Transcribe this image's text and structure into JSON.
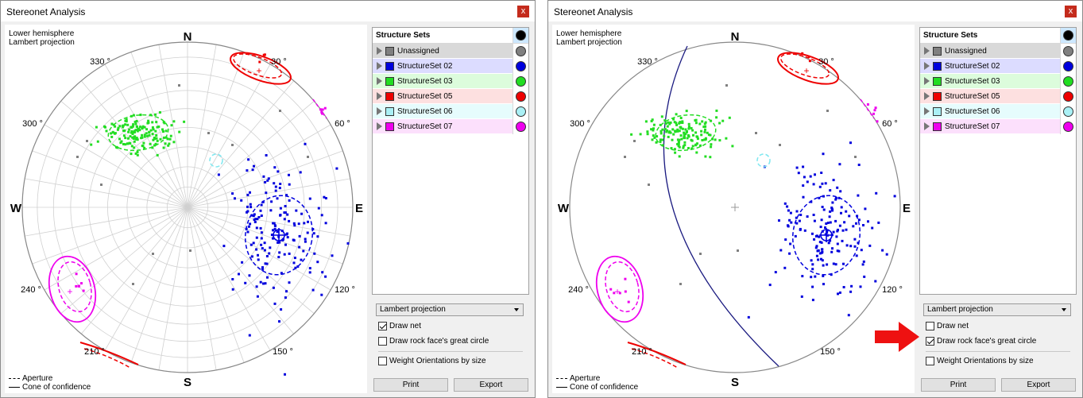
{
  "windows": [
    {
      "title": "Stereonet Analysis",
      "close_label": "x",
      "hemisphere": "Lower hemisphere",
      "projection_text": "Lambert projection",
      "net_drawn": true,
      "great_circle_drawn": false,
      "compass": {
        "n": "N",
        "s": "S",
        "e": "E",
        "w": "W"
      },
      "angles": {
        "a330": "330 °",
        "a30": "30 °",
        "a300": "300 °",
        "a60": "60 °",
        "a240": "240 °",
        "a120": "120 °",
        "a210": "210 °",
        "a150": "150 °"
      },
      "legend": {
        "aperture": "Aperture",
        "cone": "Cone of confidence"
      },
      "structure_header": "Structure Sets",
      "structures": [
        {
          "name": "Unassigned",
          "color": "#808080",
          "bg": "#d9d9d9"
        },
        {
          "name": "StructureSet 02",
          "color": "#0000dd",
          "bg": "#dcdcff"
        },
        {
          "name": "StructureSet 03",
          "color": "#22dd22",
          "bg": "#dcfcdc"
        },
        {
          "name": "StructureSet 05",
          "color": "#ee0000",
          "bg": "#fde0e0"
        },
        {
          "name": "StructureSet 06",
          "color": "#aaf0f5",
          "bg": "#e6fcfd"
        },
        {
          "name": "StructureSet 07",
          "color": "#ee00ee",
          "bg": "#fce0fc"
        }
      ],
      "combo": "Lambert projection",
      "checks": {
        "draw_net": "Draw net",
        "draw_rock": "Draw rock face's great circle",
        "weight": "Weight Orientations by size"
      },
      "buttons": {
        "print": "Print",
        "export": "Export"
      }
    },
    {
      "title": "Stereonet Analysis",
      "close_label": "x",
      "hemisphere": "Lower hemisphere",
      "projection_text": "Lambert projection",
      "net_drawn": false,
      "great_circle_drawn": true,
      "compass": {
        "n": "N",
        "s": "S",
        "e": "E",
        "w": "W"
      },
      "angles": {
        "a330": "330 °",
        "a30": "30 °",
        "a300": "300 °",
        "a60": "60 °",
        "a240": "240 °",
        "a120": "120 °",
        "a210": "210 °",
        "a150": "150 °"
      },
      "legend": {
        "aperture": "Aperture",
        "cone": "Cone of confidence"
      },
      "structure_header": "Structure Sets",
      "structures": [
        {
          "name": "Unassigned",
          "color": "#808080",
          "bg": "#d9d9d9"
        },
        {
          "name": "StructureSet 02",
          "color": "#0000dd",
          "bg": "#dcdcff"
        },
        {
          "name": "StructureSet 03",
          "color": "#22dd22",
          "bg": "#dcfcdc"
        },
        {
          "name": "StructureSet 05",
          "color": "#ee0000",
          "bg": "#fde0e0"
        },
        {
          "name": "StructureSet 06",
          "color": "#aaf0f5",
          "bg": "#e6fcfd"
        },
        {
          "name": "StructureSet 07",
          "color": "#ee00ee",
          "bg": "#fce0fc"
        }
      ],
      "combo": "Lambert projection",
      "checks": {
        "draw_net": "Draw net",
        "draw_rock": "Draw rock face's great circle",
        "weight": "Weight Orientations by size"
      },
      "buttons": {
        "print": "Print",
        "export": "Export"
      }
    }
  ],
  "annotation_arrow_color": "#ee1111"
}
